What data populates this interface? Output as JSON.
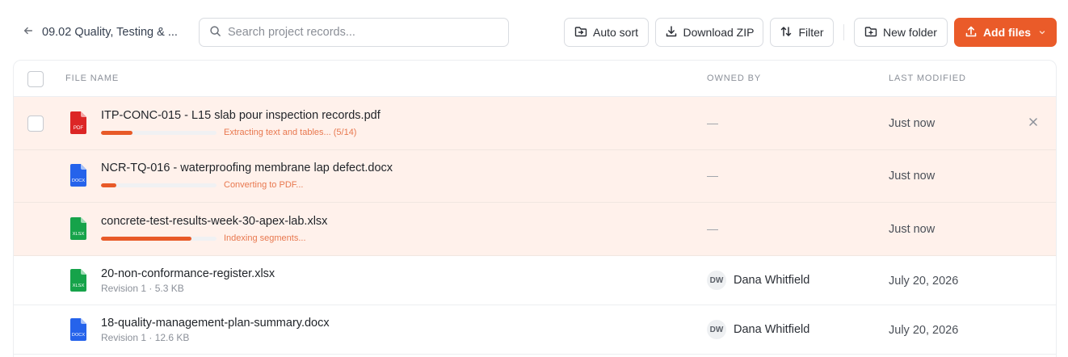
{
  "breadcrumb": {
    "label": "09.02 Quality, Testing & ..."
  },
  "search": {
    "placeholder": "Search project records..."
  },
  "toolbar": {
    "auto_sort": "Auto sort",
    "download_zip": "Download ZIP",
    "filter": "Filter",
    "new_folder": "New folder",
    "add_files": "Add files"
  },
  "table": {
    "columns": {
      "file_name": "FILE NAME",
      "owned_by": "OWNED BY",
      "last_modified": "LAST MODIFIED"
    },
    "uploads": [
      {
        "name": "ITP-CONC-015 - L15 slab pour inspection records.pdf",
        "type": "PDF",
        "progress": 0.27,
        "status": "Extracting text and tables... (5/14)",
        "owner": "—",
        "modified": "Just now"
      },
      {
        "name": "NCR-TQ-016 - waterproofing membrane lap defect.docx",
        "type": "DOCX",
        "progress": 0.13,
        "status": "Converting to PDF...",
        "owner": "—",
        "modified": "Just now"
      },
      {
        "name": "concrete-test-results-week-30-apex-lab.xlsx",
        "type": "XLSX",
        "progress": 0.78,
        "status": "Indexing segments...",
        "owner": "—",
        "modified": "Just now"
      }
    ],
    "files": [
      {
        "name": "20-non-conformance-register.xlsx",
        "type": "XLSX",
        "meta": "Revision 1 · 5.3 KB",
        "owner_initials": "DW",
        "owner": "Dana Whitfield",
        "modified": "July 20, 2026"
      },
      {
        "name": "18-quality-management-plan-summary.docx",
        "type": "DOCX",
        "meta": "Revision 1 · 12.6 KB",
        "owner_initials": "DW",
        "owner": "Dana Whitfield",
        "modified": "July 20, 2026"
      }
    ]
  },
  "colors": {
    "accent": "#ea5b29",
    "upload_row_bg": "#fff1eb",
    "pdf": "#dc2626",
    "docx": "#2563eb",
    "xlsx": "#16a34a"
  },
  "icons": {
    "back": "arrow-left-icon",
    "search": "search-icon",
    "auto_sort": "folder-sort-icon",
    "download": "download-icon",
    "filter": "sort-arrows-icon",
    "new_folder": "folder-plus-icon",
    "add": "upload-icon",
    "dismiss": "close-icon"
  }
}
